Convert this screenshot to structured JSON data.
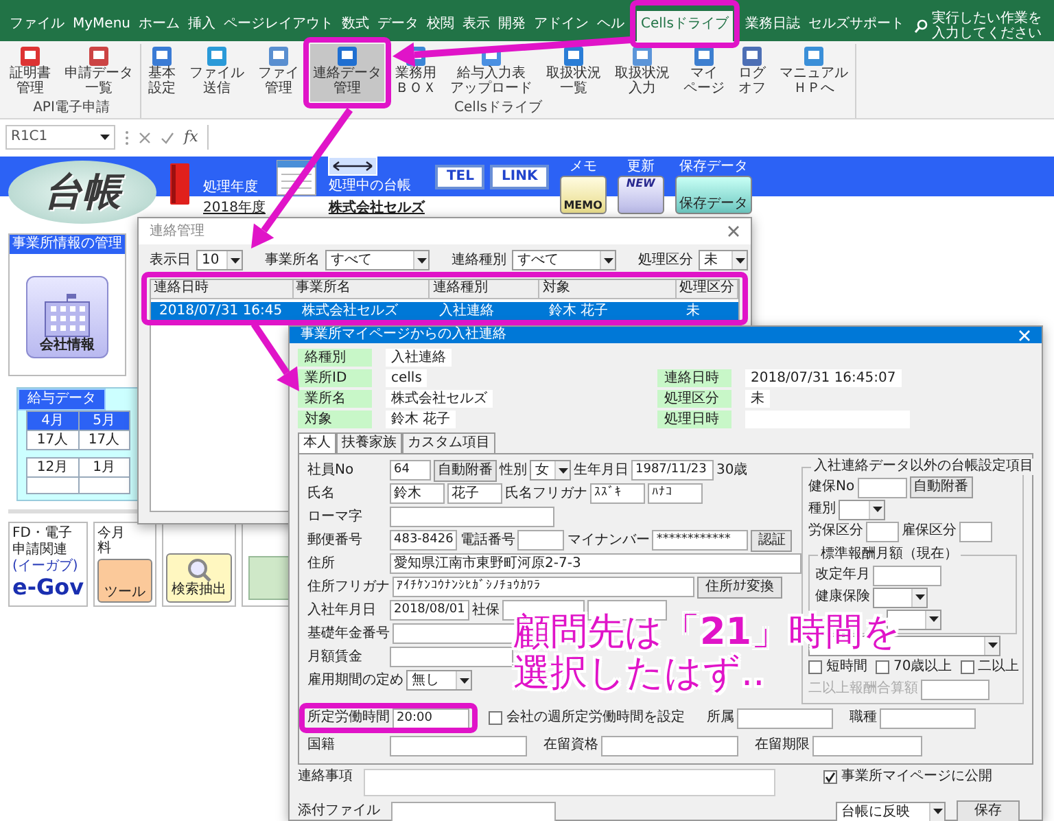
{
  "ribbon": {
    "tabs": [
      {
        "label": "ファイル",
        "selected": false
      },
      {
        "label": "MyMenu",
        "selected": false
      },
      {
        "label": "ホーム",
        "selected": false
      },
      {
        "label": "挿入",
        "selected": false
      },
      {
        "label": "ページレイアウト",
        "selected": false
      },
      {
        "label": "数式",
        "selected": false
      },
      {
        "label": "データ",
        "selected": false
      },
      {
        "label": "校閲",
        "selected": false
      },
      {
        "label": "表示",
        "selected": false
      },
      {
        "label": "開発",
        "selected": false
      },
      {
        "label": "アドイン",
        "selected": false
      },
      {
        "label": "ヘル",
        "selected": false
      },
      {
        "label": "Cellsドライブ",
        "selected": true
      },
      {
        "label": "業務日誌",
        "selected": false
      },
      {
        "label": "セルズサポート",
        "selected": false
      }
    ],
    "search_placeholder": "実行したい作業を入力してください",
    "groups": [
      {
        "label": "API電子申請",
        "buttons": [
          {
            "lines": [
              "証明書",
              "管理"
            ],
            "pressed": false
          },
          {
            "lines": [
              "申請データ",
              "一覧"
            ],
            "pressed": false
          }
        ]
      },
      {
        "label": "Cellsドライブ",
        "buttons": [
          {
            "lines": [
              "基本",
              "設定"
            ],
            "pressed": false
          },
          {
            "lines": [
              "ファイル",
              "送信"
            ],
            "pressed": false
          },
          {
            "lines": [
              "ファイ",
              "管理"
            ],
            "pressed": false
          },
          {
            "lines": [
              "連絡データ",
              "管理"
            ],
            "pressed": true
          },
          {
            "lines": [
              "業務用",
              "ＢＯＸ"
            ],
            "pressed": false
          },
          {
            "lines": [
              "給与入力表",
              "アップロード"
            ],
            "pressed": false
          },
          {
            "lines": [
              "取扱状況",
              "一覧"
            ],
            "pressed": false
          },
          {
            "lines": [
              "取扱状況",
              "入力"
            ],
            "pressed": false
          },
          {
            "lines": [
              "マイ",
              "ページ"
            ],
            "pressed": false
          },
          {
            "lines": [
              "ログ",
              "オフ"
            ],
            "pressed": false
          },
          {
            "lines": [
              "マニュアル",
              "ＨＰへ"
            ],
            "pressed": false
          }
        ]
      }
    ]
  },
  "formula_bar": {
    "cell_ref": "R1C1",
    "function_label": "fx"
  },
  "header": {
    "logo": "台帳",
    "fiscal_year_label": "処理年度",
    "fiscal_year": "2018年度",
    "ledger_label": "処理中の台帳",
    "ledger": "株式会社セルズ",
    "buttons": [
      "TEL",
      "LINK"
    ],
    "tools": [
      {
        "label": "メモ",
        "caption": "MEMO"
      },
      {
        "label": "更新",
        "caption": "NEW"
      },
      {
        "label": "保存データ",
        "caption": "保存データ"
      }
    ]
  },
  "office_panel": {
    "title": "事業所情報の管理",
    "company_button": "会社情報"
  },
  "payroll": {
    "title": "給与データ",
    "months_top": [
      "4月",
      "5月"
    ],
    "counts_top": [
      "17人",
      "17人"
    ],
    "months_bottom": [
      "12月",
      "1月"
    ]
  },
  "tiles": [
    {
      "kind": "egov",
      "caption": "FD・電子申請関連",
      "logo": "e-Gov",
      "logo_sub": "(イーガブ)"
    },
    {
      "kind": "tool",
      "caption_lines": [
        "今月",
        "料"
      ],
      "icon_label": "ツール"
    },
    {
      "kind": "search",
      "icon_label": "検索抽出"
    },
    {
      "kind": "cut"
    }
  ],
  "contact_manager": {
    "title": "連絡管理",
    "filters": [
      {
        "label": "表示日",
        "value": "10"
      },
      {
        "label": "事業所名",
        "value": "すべて"
      },
      {
        "label": "連絡種別",
        "value": "すべて"
      },
      {
        "label": "処理区分",
        "value": "未"
      }
    ],
    "columns": [
      "連絡日時",
      "事業所名",
      "連絡種別",
      "対象",
      "処理区分"
    ],
    "rows": [
      {
        "cells": [
          "2018/07/31 16:45",
          "株式会社セルズ",
          "入社連絡",
          "鈴木 花子",
          "未"
        ],
        "selected": true
      }
    ]
  },
  "hire_notice": {
    "title": "事業所マイページからの入社連絡",
    "info_left": [
      {
        "label": "絡種別",
        "value": "入社連絡"
      },
      {
        "label": "業所ID",
        "value": "cells"
      },
      {
        "label": "業所名",
        "value": "株式会社セルズ"
      },
      {
        "label": "対象",
        "value": "鈴木 花子"
      }
    ],
    "info_right": [
      {
        "label": "連絡日時",
        "value": "2018/07/31 16:45:07"
      },
      {
        "label": "処理区分",
        "value": "未"
      },
      {
        "label": "処理日時"
      }
    ],
    "tabs": [
      {
        "label": "本人",
        "selected": true
      },
      {
        "label": "扶養家族",
        "selected": false
      },
      {
        "label": "カスタム項目",
        "selected": false
      }
    ],
    "form_rows": [
      [
        {
          "kind": "label",
          "text": "社員No"
        },
        {
          "kind": "field",
          "value": "64"
        },
        {
          "kind": "button",
          "label": "自動附番"
        },
        {
          "kind": "label",
          "text": "性別"
        },
        {
          "kind": "select",
          "value": "女"
        },
        {
          "kind": "label",
          "text": "生年月日"
        },
        {
          "kind": "field",
          "value": "1987/11/23"
        },
        {
          "kind": "note",
          "text": "30歳"
        }
      ],
      [
        {
          "kind": "label",
          "text": "氏名"
        },
        {
          "kind": "field",
          "value": "鈴木"
        },
        {
          "kind": "field",
          "value": "花子"
        },
        {
          "kind": "label",
          "text": "氏名フリガナ"
        },
        {
          "kind": "field",
          "value": "ｽｽﾞｷ"
        },
        {
          "kind": "field",
          "value": "ﾊﾅｺ"
        }
      ],
      [
        {
          "kind": "label",
          "text": "ローマ字"
        },
        {
          "kind": "field"
        }
      ],
      [
        {
          "kind": "label",
          "text": "郵便番号"
        },
        {
          "kind": "field",
          "value": "483-8426"
        },
        {
          "kind": "label",
          "text": "電話番号"
        },
        {
          "kind": "field"
        },
        {
          "kind": "label",
          "text": "マイナンバー"
        },
        {
          "kind": "field",
          "value": "************"
        },
        {
          "kind": "button",
          "label": "認証"
        }
      ],
      [
        {
          "kind": "label",
          "text": "住所"
        },
        {
          "kind": "field",
          "value": "愛知県江南市東野町河原2-7-3"
        }
      ],
      [
        {
          "kind": "label",
          "text": "住所フリガナ"
        },
        {
          "kind": "field",
          "value": "ｱｲﾁｹﾝｺｳﾅﾝｼﾋｶﾞｼﾉﾁｮｳｶﾜﾗ"
        },
        {
          "kind": "button",
          "label": "住所ｶﾅ変換"
        }
      ],
      [
        {
          "kind": "label",
          "text": "入社年月日"
        },
        {
          "kind": "field",
          "value": "2018/08/01"
        },
        {
          "kind": "label",
          "text": "社保"
        },
        {
          "kind": "field"
        },
        {
          "kind": "field"
        }
      ],
      [
        {
          "kind": "label",
          "text": "基礎年金番号"
        },
        {
          "kind": "field"
        }
      ],
      [
        {
          "kind": "label",
          "text": "月額賃金"
        },
        {
          "kind": "field"
        }
      ],
      [
        {
          "kind": "label",
          "text": "雇用期間の定め"
        },
        {
          "kind": "select",
          "value": "無し"
        }
      ]
    ],
    "form_rows_bottom": [
      [
        {
          "kind": "label",
          "text": "所定労働時間"
        },
        {
          "kind": "field",
          "value": "20:00"
        },
        {
          "kind": "check",
          "label": "会社の週所定労働時間を設定",
          "checked": false
        },
        {
          "kind": "label",
          "text": "所属"
        },
        {
          "kind": "field"
        },
        {
          "kind": "label",
          "text": "職種"
        },
        {
          "kind": "field"
        }
      ],
      [
        {
          "kind": "label",
          "text": "国籍"
        },
        {
          "kind": "field"
        },
        {
          "kind": "label",
          "text": "在留資格"
        },
        {
          "kind": "field"
        },
        {
          "kind": "label",
          "text": "在留期限"
        },
        {
          "kind": "field"
        }
      ]
    ],
    "side_panel": {
      "title": "入社連絡データ以外の台帳設定項目",
      "rows_top": [
        [
          {
            "kind": "label",
            "text": "健保No"
          },
          {
            "kind": "field"
          },
          {
            "kind": "button",
            "label": "自動附番"
          }
        ],
        [
          {
            "kind": "label",
            "text": "種別"
          },
          {
            "kind": "select"
          }
        ],
        [
          {
            "kind": "label",
            "text": "労保区分"
          },
          {
            "kind": "field"
          },
          {
            "kind": "label",
            "text": "雇保区分"
          },
          {
            "kind": "field"
          }
        ]
      ],
      "sub_title": "標準報酬月額（現在）",
      "sub_rows": [
        [
          {
            "kind": "label",
            "text": "改定年月"
          },
          {
            "kind": "field"
          }
        ],
        [
          {
            "kind": "label",
            "text": "健康保険"
          },
          {
            "kind": "select"
          }
        ],
        [
          {
            "kind": "select"
          }
        ]
      ],
      "rows_bottom": [
        [
          {
            "kind": "select"
          }
        ],
        [
          {
            "kind": "check",
            "label": "短時間",
            "checked": false
          },
          {
            "kind": "check",
            "label": "70歳以上",
            "checked": false
          },
          {
            "kind": "check",
            "label": "二以上",
            "checked": false
          }
        ],
        [
          {
            "kind": "label",
            "text": "二以上報酬合算額",
            "disabled": true
          },
          {
            "kind": "field",
            "disabled": false
          }
        ]
      ]
    },
    "notes_label": "連絡事項",
    "publish": {
      "label": "事業所マイページに公開",
      "checked": true
    },
    "attach_label": "添付ファイル",
    "reflect_select": "台帳に反映",
    "save_button": "保存"
  },
  "annotation": {
    "lines": [
      "顧問先は「**21**」時間を",
      "選択したはず.."
    ]
  }
}
